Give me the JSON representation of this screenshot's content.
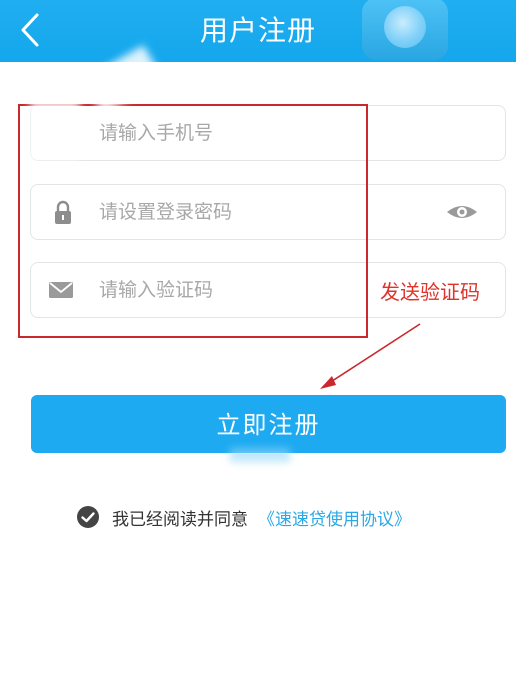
{
  "header": {
    "title": "用户注册"
  },
  "form": {
    "phone_placeholder": "请输入手机号",
    "password_placeholder": "请设置登录密码",
    "code_placeholder": "请输入验证码"
  },
  "annotation": {
    "send_code_label": "发送验证码"
  },
  "submit_label": "立即注册",
  "agreement": {
    "text": "我已经阅读并同意",
    "link": "《速速贷使用协议》"
  },
  "colors": {
    "brand": "#1eaaf1",
    "annotation": "#e0312a",
    "link": "#2aa8e6"
  },
  "icons": [
    "back-chevron-icon",
    "lock-icon",
    "eye-icon",
    "mail-icon",
    "check-circle-icon"
  ]
}
